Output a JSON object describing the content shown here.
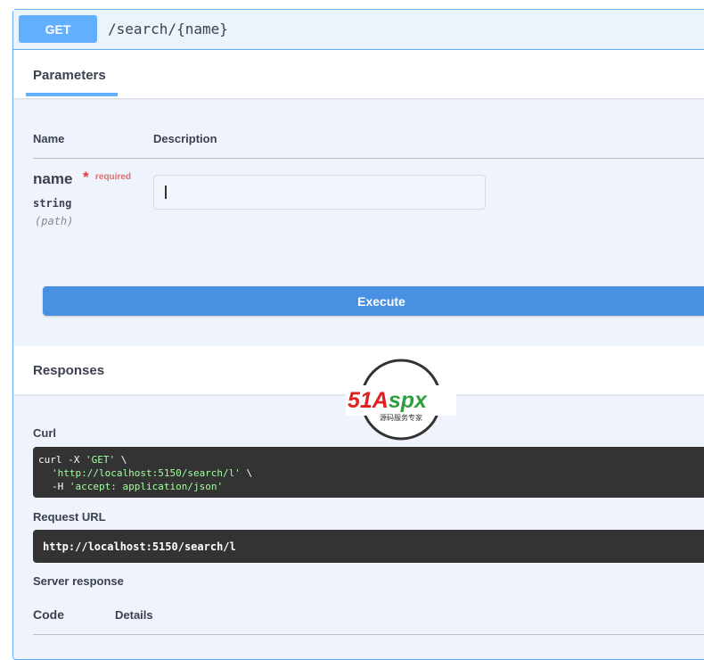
{
  "operation": {
    "method": "GET",
    "path": "/search/{name}"
  },
  "parameters": {
    "tab_label": "Parameters",
    "col_name": "Name",
    "col_description": "Description",
    "items": [
      {
        "name": "name",
        "required_star": "*",
        "required_label": "required",
        "type": "string",
        "in": "(path)",
        "value": ""
      }
    ]
  },
  "execute_label": "Execute",
  "responses": {
    "title": "Responses",
    "curl_label": "Curl",
    "curl_line1_prefix": "curl -X ",
    "curl_line1_method": "'GET'",
    "curl_line1_suffix": " \\",
    "curl_line2_url": "'http://localhost:5150/search/l'",
    "curl_line2_suffix": " \\",
    "curl_line3_prefix": "-H ",
    "curl_line3_header": "'accept: application/json'",
    "request_url_label": "Request URL",
    "request_url": "http://localhost:5150/search/l",
    "server_response_label": "Server response",
    "col_code": "Code",
    "col_details": "Details"
  },
  "watermark": {
    "brand": "51Aspx",
    "tagline": "源码服务专家",
    "colors": {
      "red": "#e02020",
      "green": "#2e9e3e",
      "ring": "#333333"
    }
  },
  "colors": {
    "accent": "#61affe",
    "execute": "#4990e2",
    "code_bg": "#333333",
    "code_string": "#a2fca2"
  }
}
